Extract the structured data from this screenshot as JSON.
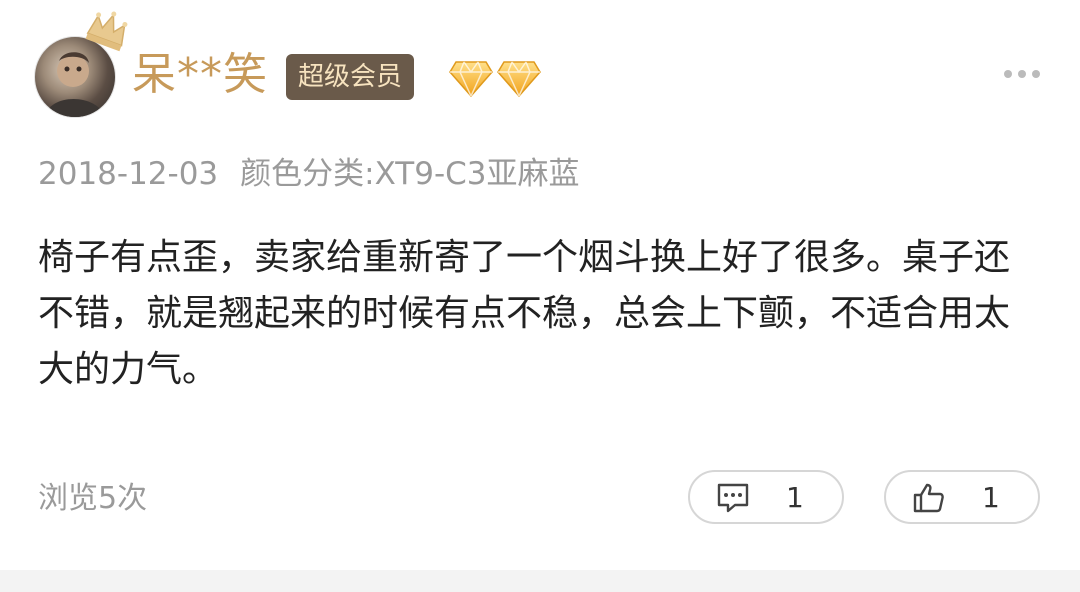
{
  "user": {
    "name": "呆**笑",
    "badge": "超级会员",
    "diamond_count": 2,
    "name_color": "#c79a5a"
  },
  "review": {
    "date": "2018-12-03",
    "variant": "颜色分类:XT9-C3亚麻蓝",
    "text": "椅子有点歪，卖家给重新寄了一个烟斗换上好了很多。桌子还不错，就是翘起来的时候有点不稳，总会上下颤，不适合用太大的力气。"
  },
  "stats": {
    "views": "浏览5次",
    "comments": "1",
    "likes": "1"
  },
  "icons": {
    "crown": "crown-icon",
    "diamond": "diamond-icon",
    "more": "more-dots-icon",
    "comment": "comment-icon",
    "like": "thumbs-up-icon"
  }
}
